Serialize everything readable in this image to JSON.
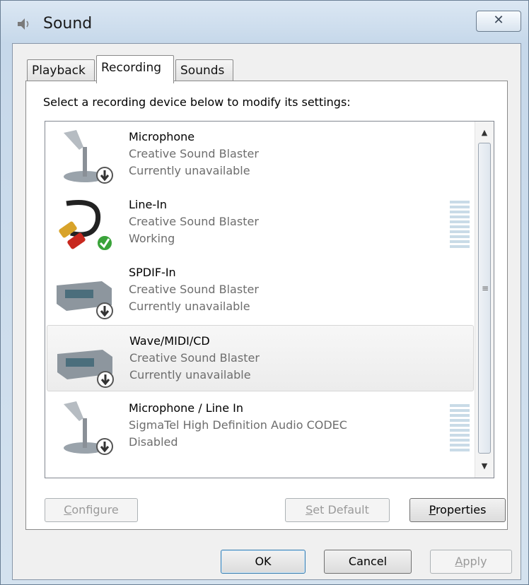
{
  "window": {
    "title": "Sound",
    "close_glyph": "✕"
  },
  "tabs": [
    {
      "label": "Playback"
    },
    {
      "label": "Recording"
    },
    {
      "label": "Sounds"
    }
  ],
  "instruction": "Select a recording device below to modify its settings:",
  "devices": [
    {
      "name": "Microphone",
      "driver": "Creative Sound Blaster",
      "status": "Currently unavailable",
      "icon": "microphone-icon",
      "badge": "down-arrow",
      "meter": false
    },
    {
      "name": "Line-In",
      "driver": "Creative Sound Blaster",
      "status": "Working",
      "icon": "rca-cable-icon",
      "badge": "check",
      "meter": true
    },
    {
      "name": "SPDIF-In",
      "driver": "Creative Sound Blaster",
      "status": "Currently unavailable",
      "icon": "device-box-icon",
      "badge": "down-arrow",
      "meter": false
    },
    {
      "name": "Wave/MIDI/CD",
      "driver": "Creative Sound Blaster",
      "status": "Currently unavailable",
      "icon": "device-box-icon",
      "badge": "down-arrow",
      "meter": false,
      "selected": true
    },
    {
      "name": "Microphone / Line In",
      "driver": "SigmaTel High Definition Audio CODEC",
      "status": "Disabled",
      "icon": "microphone-icon",
      "badge": "down-arrow",
      "meter": true
    }
  ],
  "buttons": {
    "configure": {
      "mnemonic": "C",
      "rest": "onfigure"
    },
    "set_default": {
      "mnemonic": "S",
      "rest": "et Default"
    },
    "properties": {
      "mnemonic": "P",
      "rest": "roperties"
    },
    "ok": "OK",
    "cancel": "Cancel",
    "apply": {
      "mnemonic": "A",
      "rest": "pply"
    }
  },
  "colors": {
    "accent": "#3c7fb1",
    "meter": "#c9dbe7",
    "check_badge": "#3aa33a"
  }
}
